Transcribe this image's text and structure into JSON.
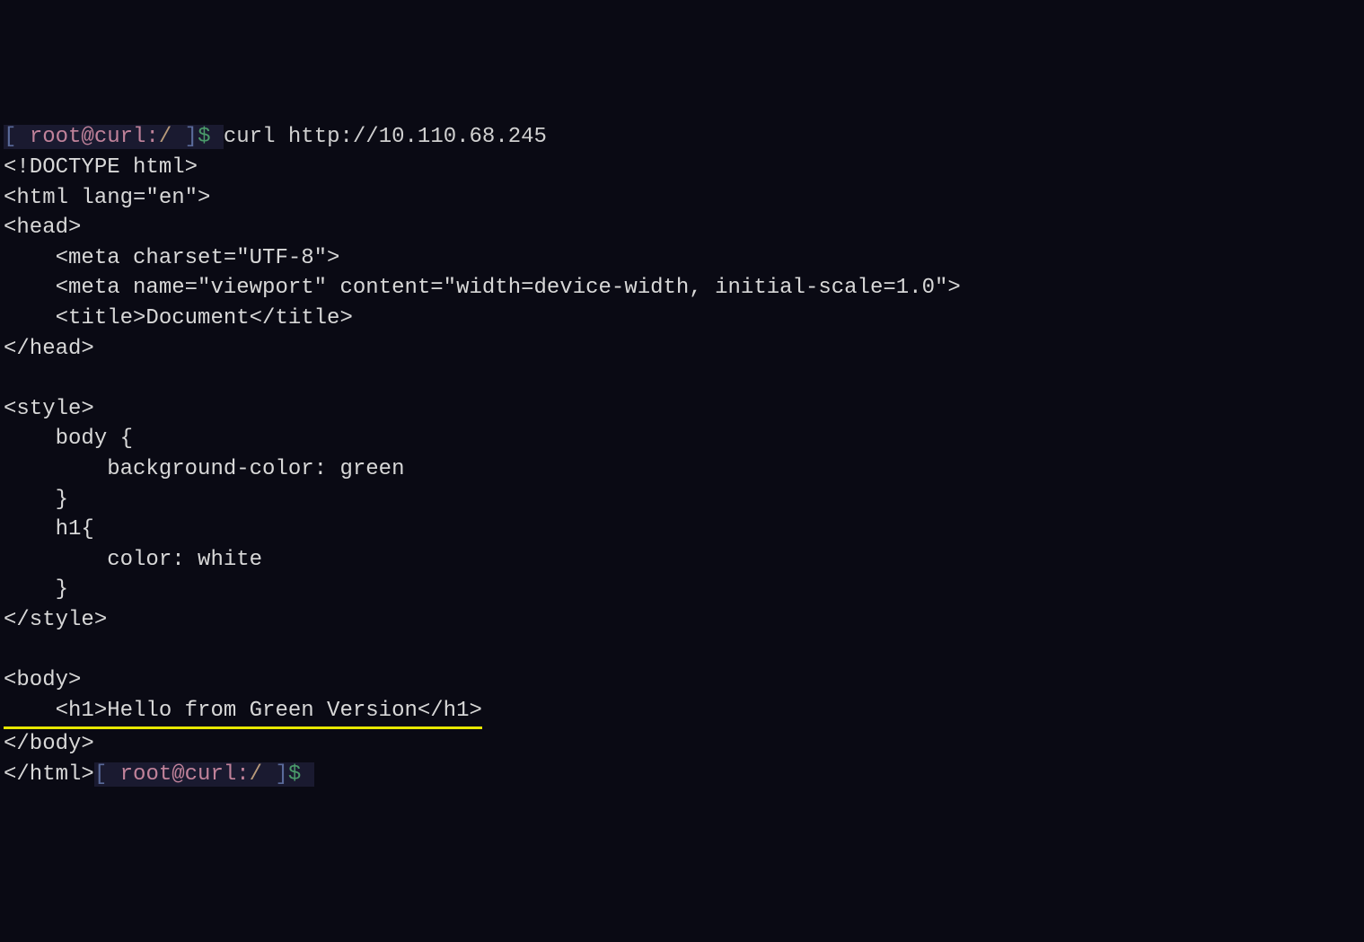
{
  "prompt1": {
    "bracket_open": "[ ",
    "user": "root",
    "at": "@",
    "host": "curl",
    "colon": ":",
    "path": "/",
    "bracket_close": " ]",
    "dollar": "$ "
  },
  "command1": "curl http://10.110.68.245",
  "output": {
    "l1": "<!DOCTYPE html>",
    "l2": "<html lang=\"en\">",
    "l3": "<head>",
    "l4": "    <meta charset=\"UTF-8\">",
    "l5": "    <meta name=\"viewport\" content=\"width=device-width, initial-scale=1.0\">",
    "l6": "    <title>Document</title>",
    "l7": "</head>",
    "l8": "",
    "l9": "<style>",
    "l10": "    body {",
    "l11": "        background-color: green",
    "l12": "    }",
    "l13": "    h1{",
    "l14": "        color: white",
    "l15": "    }",
    "l16": "</style>",
    "l17": "",
    "l18": "<body>",
    "l19": "    <h1>Hello from Green Version</h1>",
    "l20": "</body>",
    "l21": "</html>"
  },
  "prompt2": {
    "bracket_open": "[ ",
    "user": "root",
    "at": "@",
    "host": "curl",
    "colon": ":",
    "path": "/",
    "bracket_close": " ]",
    "dollar": "$ "
  }
}
